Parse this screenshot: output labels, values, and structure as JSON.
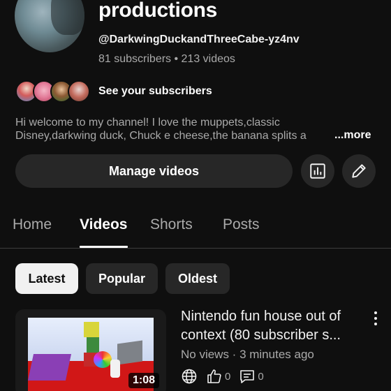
{
  "channel": {
    "name": "productions",
    "handle": "@DarkwingDuckandThreeCabe-yz4nv",
    "stats": "81 subscribers • 213 videos",
    "see_subscribers": "See your subscribers",
    "description_line1": "Hi welcome to my channel! I love the muppets,classic",
    "description_line2": "Disney,darkwing duck, Chuck e cheese,the banana splits a",
    "more": "...more",
    "manage_videos": "Manage videos"
  },
  "icons": {
    "stats": "bar-chart-icon",
    "edit": "pencil-icon",
    "visibility": "globe-icon",
    "like": "thumbs-up-icon",
    "comments": "comment-icon",
    "menu": "kebab-menu-icon"
  },
  "tabs": [
    {
      "label": "Home",
      "active": false
    },
    {
      "label": "Videos",
      "active": true
    },
    {
      "label": "Shorts",
      "active": false
    },
    {
      "label": "Posts",
      "active": false
    }
  ],
  "filters": [
    {
      "label": "Latest",
      "selected": true
    },
    {
      "label": "Popular",
      "selected": false
    },
    {
      "label": "Oldest",
      "selected": false
    }
  ],
  "video": {
    "title_line1": "Nintendo fun house out of",
    "title_line2": "context (80 subscriber s...",
    "meta": "No views · 3 minutes ago",
    "duration": "1:08",
    "likes": "0",
    "comments": "0"
  },
  "colors": {
    "background": "#0f0f0f",
    "surface": "#272727",
    "text_primary": "#f1f1f1",
    "text_secondary": "#aaaaaa",
    "selected_chip": "#f1f1f1"
  }
}
